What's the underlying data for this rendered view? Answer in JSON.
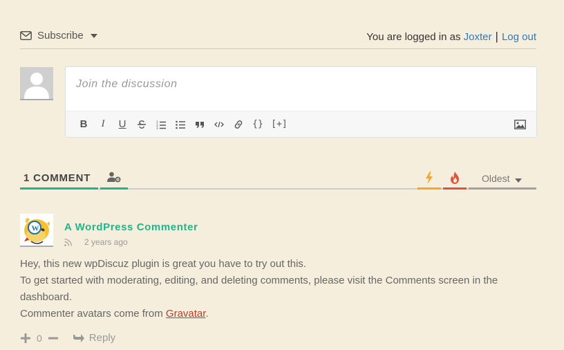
{
  "subscribe": {
    "label": "Subscribe"
  },
  "login": {
    "prefix": "You are logged in as",
    "username": "Joxter",
    "separator": "|",
    "logout": "Log out"
  },
  "editor": {
    "placeholder": "Join the discussion"
  },
  "toolbar": {
    "buttons": [
      "bold-icon",
      "italic-icon",
      "underline-icon",
      "strikethrough-icon",
      "ordered-list-icon",
      "unordered-list-icon",
      "blockquote-icon",
      "code-icon",
      "link-icon",
      "source-code-icon",
      "spoiler-icon"
    ],
    "bold": "B",
    "italic": "I",
    "underline": "U",
    "source_code": "{}",
    "spoiler": "[+]"
  },
  "thread": {
    "count_label": "1 COMMENT",
    "sort_label": "Oldest"
  },
  "comment": {
    "author": "A WordPress Commenter",
    "time": "2 years ago",
    "lines": [
      "Hey, this new wpDiscuz plugin is great you have to try out this.",
      "To get started with moderating, editing, and deleting comments, please visit the Comments screen in the dashboard."
    ],
    "line3_prefix": "Commenter avatars come from ",
    "line3_link": "Gravatar",
    "line3_suffix": ".",
    "votes": "0",
    "reply_label": "Reply"
  },
  "colors": {
    "background": "#f5eedd",
    "accent": "#1db68c",
    "link": "#2a7bbf",
    "hot": "#f5a623",
    "fire": "#e0533a",
    "gravatar": "#c0392b"
  }
}
